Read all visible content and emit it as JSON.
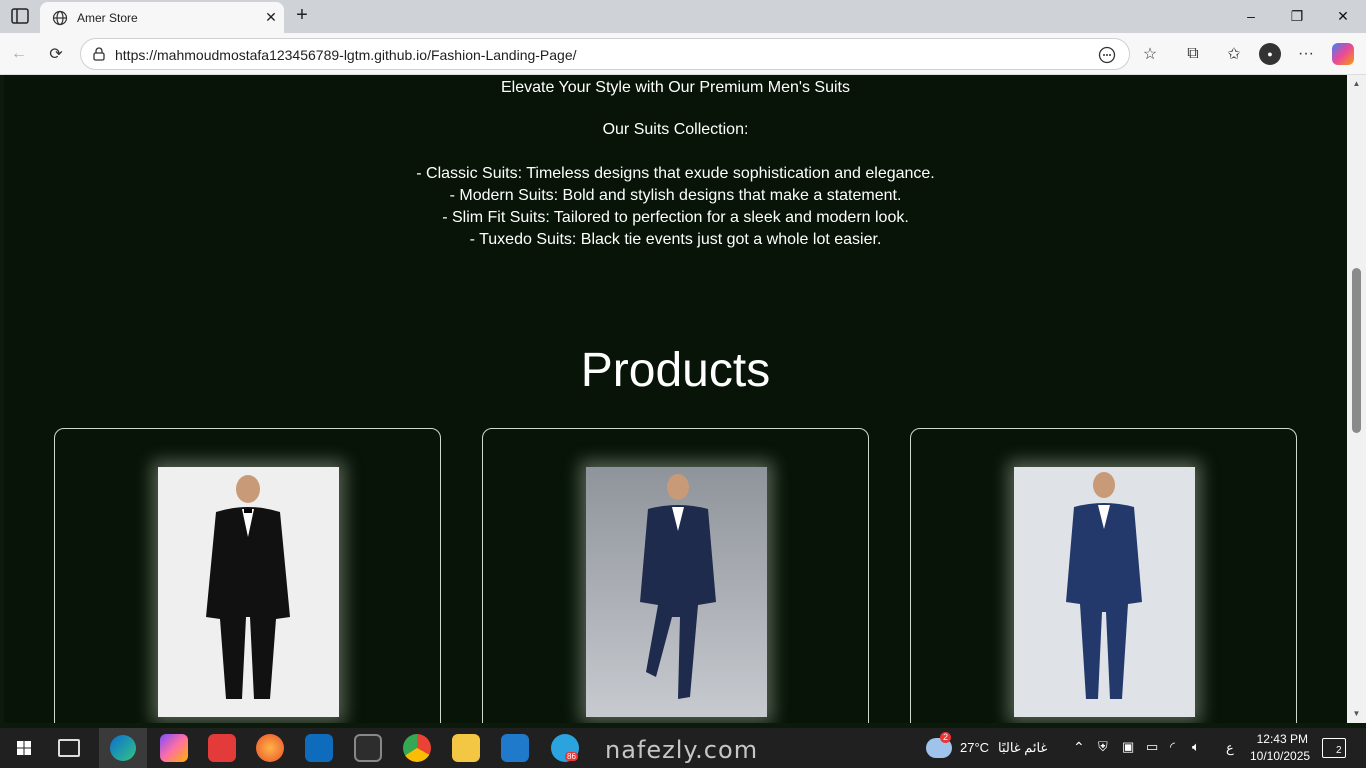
{
  "browser": {
    "tab_title": "Amer Store",
    "new_tab": "+",
    "url": "https://mahmoudmostafa123456789-lgtm.github.io/Fashion-Landing-Page/",
    "window": {
      "minimize": "–",
      "restore": "❐",
      "close": "✕"
    }
  },
  "page": {
    "tagline": "Elevate Your Style with Our Premium Men's Suits",
    "collection_heading": "Our Suits Collection:",
    "collection_items": [
      "- Classic Suits: Timeless designs that exude sophistication and elegance.",
      "- Modern Suits: Bold and stylish designs that make a statement.",
      "- Slim Fit Suits: Tailored to perfection for a sleek and modern look.",
      "- Tuxedo Suits: Black tie events just got a whole lot easier."
    ],
    "products_title": "Products",
    "products": [
      {
        "name": "black-tuxedo",
        "bg": "#efefef",
        "jacket": "#111111"
      },
      {
        "name": "navy-tuxedo-grey",
        "bg": "#a9adb3",
        "jacket": "#1e2b4d"
      },
      {
        "name": "blue-tuxedo",
        "bg": "#dfe2e6",
        "jacket": "#23396b"
      }
    ]
  },
  "taskbar": {
    "weather_temp": "27°C",
    "weather_text": "غائم غالبًا",
    "weather_badge": "2",
    "lang": "ع",
    "time": "12:43 PM",
    "date": "10/10/2025",
    "notification_count": "2",
    "telegram_badge": "86",
    "watermark": "nafezly.com"
  },
  "colors": {
    "page_bg": "#071407",
    "card_border": "#cfd8cf",
    "taskbar": "#202020"
  }
}
